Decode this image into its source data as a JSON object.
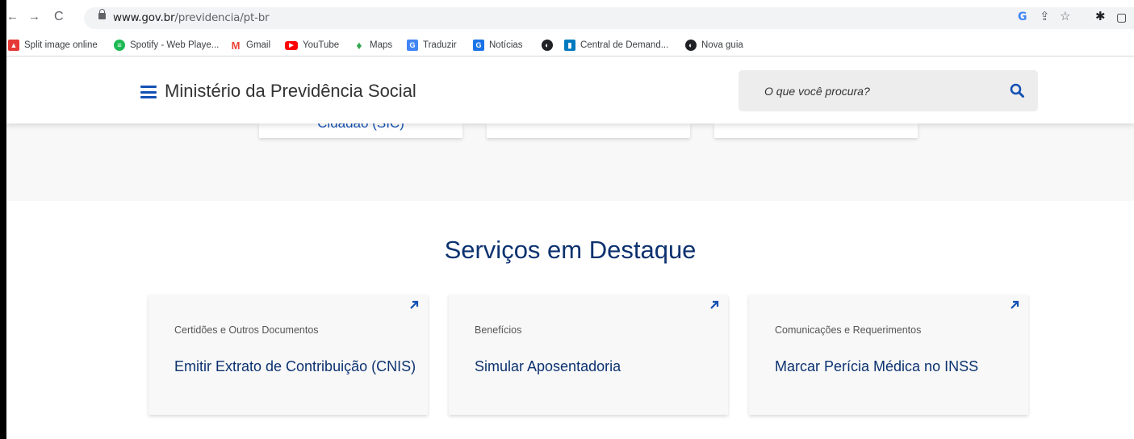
{
  "browser": {
    "url_host": "www.gov.br",
    "url_path": "/previdencia/pt-br",
    "bookmarks": [
      {
        "label": "Split image online",
        "icon": "split-image-icon",
        "color": "#e53935"
      },
      {
        "label": "Spotify - Web Playe...",
        "icon": "spotify-icon",
        "color": "#1db954"
      },
      {
        "label": "Gmail",
        "icon": "gmail-icon",
        "color": "#ea4335"
      },
      {
        "label": "YouTube",
        "icon": "youtube-icon",
        "color": "#ff0000"
      },
      {
        "label": "Maps",
        "icon": "maps-icon",
        "color": "#34a853"
      },
      {
        "label": "Traduzir",
        "icon": "translate-icon",
        "color": "#4285f4"
      },
      {
        "label": "Notícias",
        "icon": "news-icon",
        "color": "#1a73e8"
      },
      {
        "label": "",
        "icon": "globe-icon",
        "color": "#202124"
      },
      {
        "label": "Central de Demand...",
        "icon": "trello-icon",
        "color": "#0079bf"
      },
      {
        "label": "Nova guia",
        "icon": "globe-icon",
        "color": "#202124"
      }
    ]
  },
  "header": {
    "title": "Ministério da Previdência Social",
    "search_placeholder": "O que você procura?"
  },
  "top_cards": [
    {
      "label": "Cidadão (SIC)"
    },
    {
      "label": ""
    },
    {
      "label": ""
    }
  ],
  "services": {
    "title": "Serviços em Destaque",
    "cards": [
      {
        "category": "Certidões e Outros Documentos",
        "title": "Emitir Extrato de Contribuição (CNIS)"
      },
      {
        "category": "Benefícios",
        "title": "Simular Aposentadoria"
      },
      {
        "category": "Comunicações e Requerimentos",
        "title": "Marcar Perícia Médica no INSS"
      }
    ]
  },
  "colors": {
    "brand_blue": "#1351b4",
    "title_blue": "#0c326f"
  }
}
